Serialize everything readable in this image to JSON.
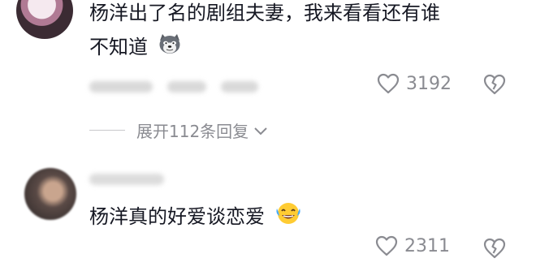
{
  "comments": [
    {
      "text_line1": "杨洋出了名的剧组夫妻，我来看看还有谁",
      "text_line2": "不知道",
      "emoji": "dog-emoji-icon",
      "likes": "3192",
      "replies_label": "展开112条回复"
    },
    {
      "text_line1": "杨洋真的好爱谈恋爱",
      "emoji": "laughing-tears-emoji-icon",
      "likes": "2311"
    }
  ],
  "colors": {
    "text": "#161823",
    "muted": "#8a8b91"
  }
}
